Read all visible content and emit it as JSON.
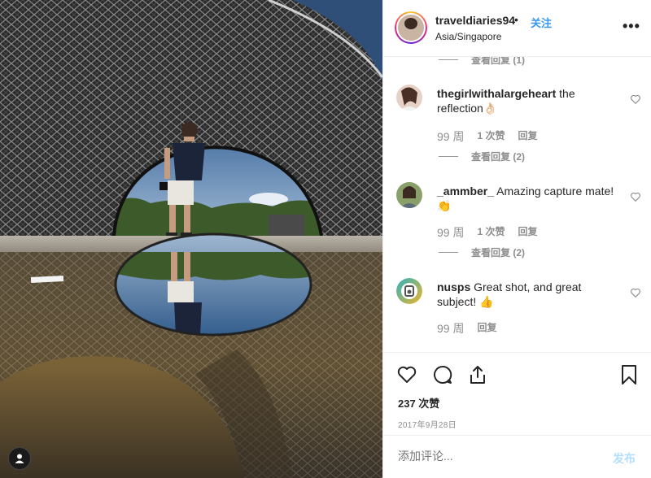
{
  "post": {
    "username": "traveldiaries94",
    "dot": "•",
    "follow_label": "关注",
    "location": "Asia/Singapore",
    "more_label": "•••"
  },
  "comments": {
    "top_view_replies": "查看回复 (1)",
    "items": [
      {
        "user": "thegirlwithalargeheart",
        "text": "the reflection👌🏻",
        "time": "99 周",
        "likes": "1 次赞",
        "reply_label": "回复",
        "view_replies": "查看回复 (2)"
      },
      {
        "user": "_ammber_",
        "text": "Amazing capture mate! 👏",
        "time": "99 周",
        "likes": "1 次赞",
        "reply_label": "回复",
        "view_replies": "查看回复 (2)"
      },
      {
        "user": "nusps",
        "text": "Great shot, and great subject! 👍",
        "time": "99 周",
        "reply_label": "回复"
      }
    ]
  },
  "actions": {
    "likes_count": "237 次赞",
    "date": "2017年9月28日"
  },
  "add_comment": {
    "placeholder": "添加评论...",
    "post_label": "发布"
  },
  "colors": {
    "accent": "#3897f0",
    "muted": "#8e8e8e",
    "post_disabled": "#b2dffc"
  }
}
